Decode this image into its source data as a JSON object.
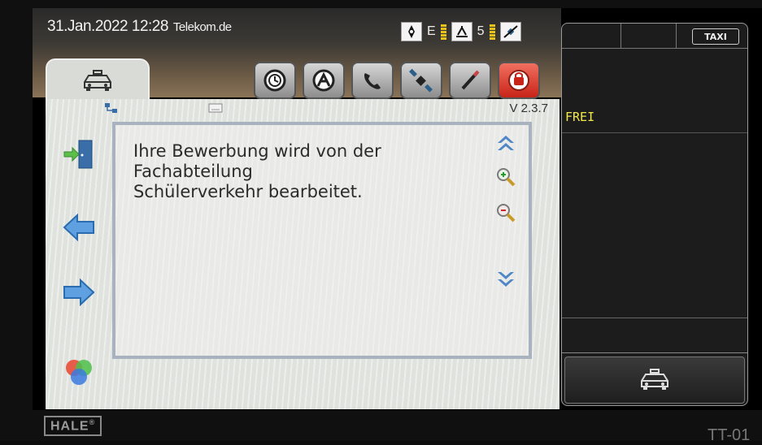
{
  "header": {
    "date_time": "31.Jan.2022 12:28",
    "provider": "Telekom.de",
    "network_label": "E",
    "satellites": "5",
    "version": "V 2.3.7"
  },
  "toolbar": {
    "buttons": [
      "clock-icon",
      "taximeter-icon",
      "phone-icon",
      "satellite-icon",
      "pen-icon",
      "alarm-icon"
    ]
  },
  "message": {
    "lines": [
      "Ihre Bewerbung wird von der",
      "Fachabteilung",
      "Schülerverkehr bearbeitet."
    ]
  },
  "right_panel": {
    "taxi_badge": "TAXI",
    "status": "FREI"
  },
  "device": {
    "brand": "HALE",
    "brand_mark": "®",
    "model": "TT-01"
  },
  "colors": {
    "status_text": "#f3e84a",
    "panel_bg": "#e4e6e2",
    "message_border": "#a9b3bf",
    "alarm_button": "#d0321f"
  }
}
